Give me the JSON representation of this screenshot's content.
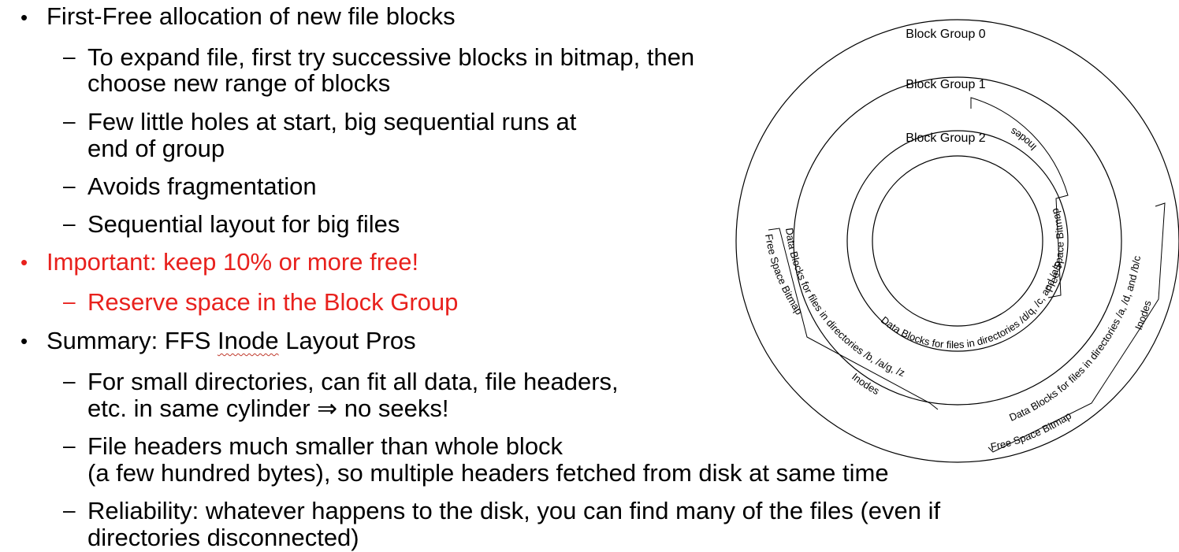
{
  "colors": {
    "text": "#000000",
    "accent": "#e8211d"
  },
  "bullets": {
    "b1": {
      "text": "First-Free allocation of new file blocks"
    },
    "b1_subs": {
      "s1_line1": "To expand file, first try successive blocks in bitmap, then",
      "s1_line2": "choose new range of blocks",
      "s2_line1": "Few little holes at start, big sequential runs at",
      "s2_line2": "end of group",
      "s3": "Avoids fragmentation",
      "s4": "Sequential layout for big files"
    },
    "b2": {
      "text": "Important: keep 10% or more free!"
    },
    "b2_subs": {
      "s1": "Reserve space in the Block Group"
    },
    "b3": {
      "prefix": "Summary: FFS ",
      "word": "Inode",
      "suffix": " Layout Pros"
    },
    "b3_subs": {
      "s1_line1": "For small directories, can fit all data, file headers,",
      "s1_line2": "etc. in same cylinder ⇒ no seeks!",
      "s2_line1": "File headers much smaller than whole block",
      "s2_line2": "(a few hundred bytes), so multiple headers fetched from disk at same time",
      "s3_line1": "Reliability: whatever happens to the disk, you can find many of the files (even if",
      "s3_line2": "directories disconnected)"
    }
  },
  "diagram": {
    "groups": [
      "Block Group 0",
      "Block Group 1",
      "Block Group 2"
    ],
    "g0": {
      "free_space": "Free Space Bitmap",
      "inodes": "Inodes",
      "data": "Data Blocks for files in directories /a, /d, and /b/c"
    },
    "g1": {
      "free_space": "Free Space Bitmap",
      "inodes": "Inodes",
      "data": "Data Blocks for files in directories /b, /a/g, /z"
    },
    "g2": {
      "free_space": "Free Space Bitmap",
      "inodes": "Inodes",
      "data": "Data Blocks for files in directories /d/q, /c, and /a/p"
    }
  }
}
